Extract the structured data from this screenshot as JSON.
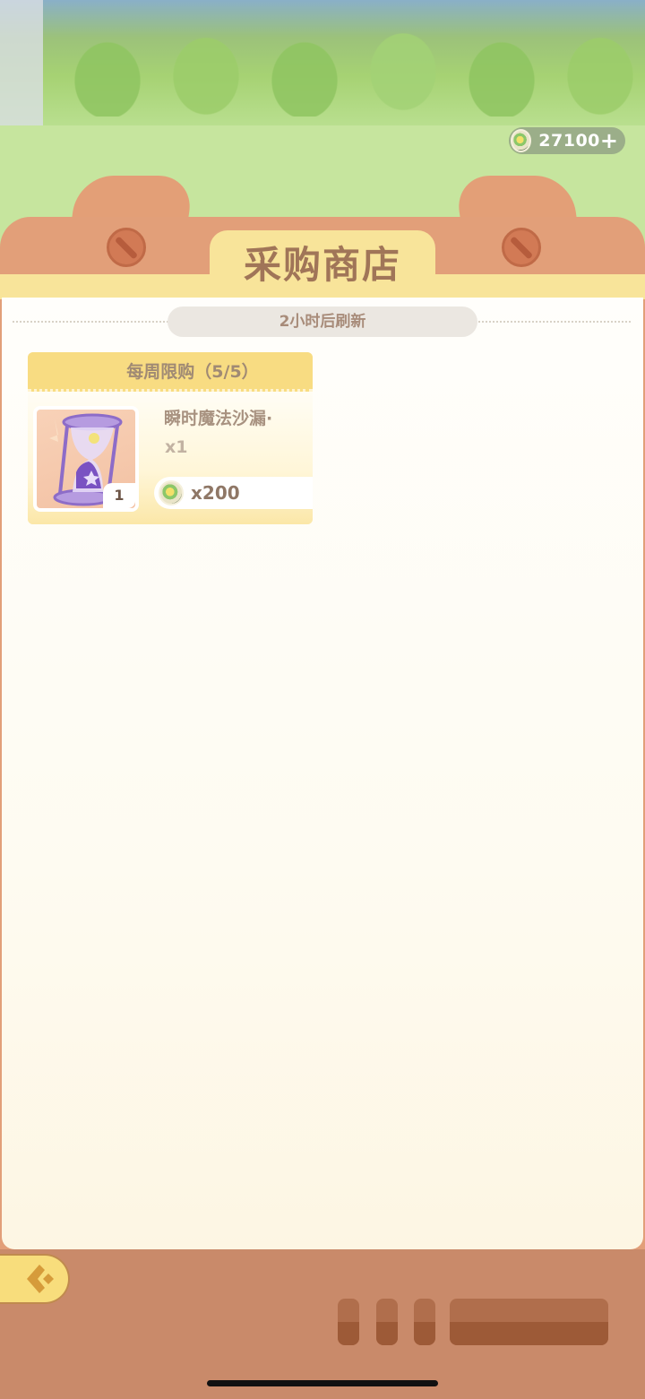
{
  "currency": {
    "amount": "27100",
    "add_icon": "plus-icon",
    "coin_icon": "coin-icon"
  },
  "shop": {
    "title": "采购商店",
    "refresh_text": "2小时后刷新"
  },
  "card": {
    "limit_label": "每周限购（5/5）",
    "item_name": "瞬时魔法沙漏·",
    "item_qty": "x1",
    "item_count": "1",
    "price": "x200",
    "item_icon": "hourglass-icon"
  },
  "nav": {
    "back_icon": "back-arrow-icon"
  }
}
